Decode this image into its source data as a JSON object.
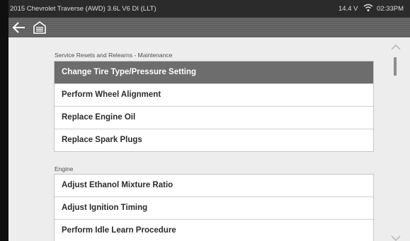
{
  "statusbar": {
    "title": "2015 Chevrolet Traverse (AWD) 3.6L V6 DI (LLT)",
    "voltage": "14.4 V",
    "time": "02:33PM",
    "wifi_icon": "wifi-icon"
  },
  "toolbar": {
    "back_icon": "back-arrow-icon",
    "home_icon": "garage-home-icon"
  },
  "sections": [
    {
      "label": "Service Resets and Relearns - Maintenance",
      "items": [
        {
          "label": "Change Tire Type/Pressure Setting",
          "selected": true
        },
        {
          "label": "Perform Wheel Alignment",
          "selected": false
        },
        {
          "label": "Replace Engine Oil",
          "selected": false
        },
        {
          "label": "Replace Spark Plugs",
          "selected": false
        }
      ]
    },
    {
      "label": "Engine",
      "items": [
        {
          "label": "Adjust Ethanol Mixture Ratio",
          "selected": false
        },
        {
          "label": "Adjust Ignition Timing",
          "selected": false
        },
        {
          "label": "Perform Idle Learn Procedure",
          "selected": false
        }
      ]
    }
  ],
  "colors": {
    "selected_row": "#6d6d6d",
    "status_bar": "#2b2b2b",
    "background": "#ededed"
  }
}
